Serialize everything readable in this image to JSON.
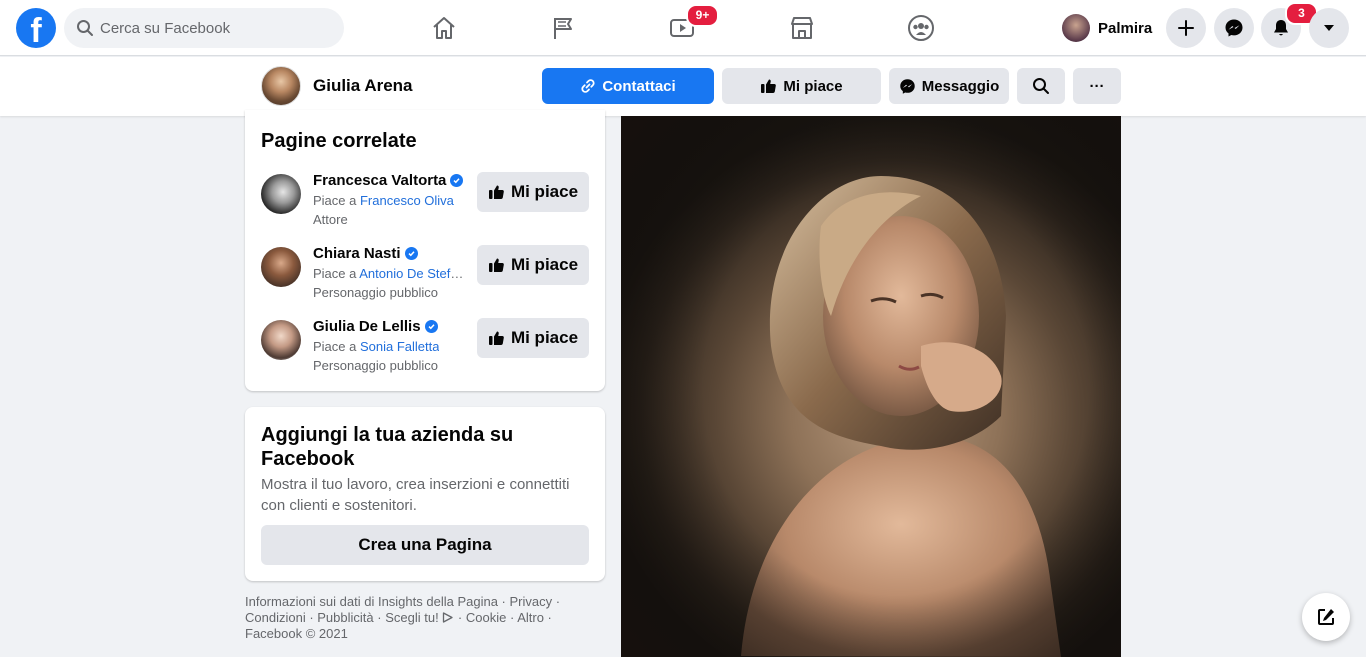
{
  "topbar": {
    "search_placeholder": "Cerca su Facebook",
    "logo_letter": "f",
    "watch_badge": "9+",
    "user_name": "Palmira",
    "notifications_badge": "3"
  },
  "page_header": {
    "name": "Giulia Arena",
    "contact_label": "Contattaci",
    "like_label": "Mi piace",
    "message_label": "Messaggio",
    "more_label": "···"
  },
  "related": {
    "title": "Pagine correlate",
    "items": [
      {
        "name": "Francesca Valtorta",
        "liked_prefix": "Piace a ",
        "liked_by": "Francesco Oliva",
        "category": "Attore",
        "button": "Mi piace"
      },
      {
        "name": "Chiara Nasti",
        "liked_prefix": "Piace a ",
        "liked_by": "Antonio De Stefa...",
        "category": "Personaggio pubblico",
        "button": "Mi piace"
      },
      {
        "name": "Giulia De Lellis",
        "liked_prefix": "Piace a ",
        "liked_by": "Sonia Falletta",
        "category": "Personaggio pubblico",
        "button": "Mi piace"
      }
    ]
  },
  "business": {
    "title": "Aggiungi la tua azienda su Facebook",
    "description": "Mostra il tuo lavoro, crea inserzioni e connettiti con clienti e sostenitori.",
    "button": "Crea una Pagina"
  },
  "footer": {
    "links": [
      "Informazioni sui dati di Insights della Pagina",
      "Privacy",
      "Condizioni",
      "Pubblicità",
      "Scegli tu!",
      "Cookie",
      "Altro",
      "Facebook © 2021"
    ],
    "sep": " · "
  },
  "colors": {
    "brand": "#1877f2",
    "badge": "#e41e3f",
    "link": "#216fdb"
  }
}
